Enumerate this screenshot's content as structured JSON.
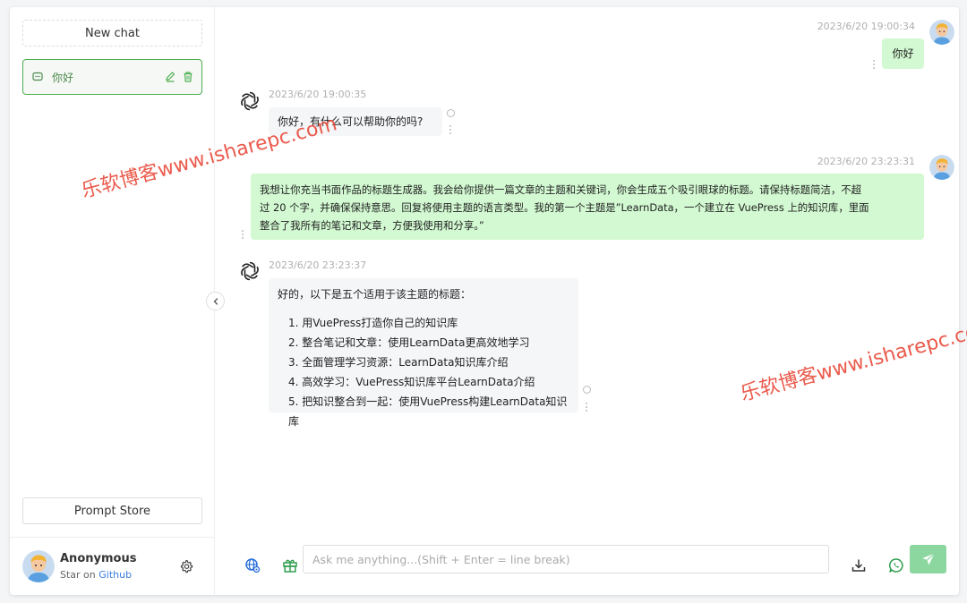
{
  "sidebar": {
    "new_chat_label": "New chat",
    "conversations": [
      {
        "title": "你好"
      }
    ],
    "prompt_store_label": "Prompt Store",
    "user": {
      "name": "Anonymous",
      "sub_prefix": "Star on",
      "sub_link": "Github"
    }
  },
  "messages": [
    {
      "role": "user",
      "time": "2023/6/20 19:00:34",
      "text": "你好"
    },
    {
      "role": "assistant",
      "time": "2023/6/20 19:00:35",
      "text": "你好，有什么可以帮助你的吗?"
    },
    {
      "role": "user",
      "time": "2023/6/20 23:23:31",
      "lines": [
        "我想让你充当书面作品的标题生成器。我会给你提供一篇文章的主题和关键词，你会生成五个吸引眼球的标题。请保持标题简洁，不超",
        "过 20 个字，并确保保持意思。回复将使用主题的语言类型。我的第一个主题是”LearnData，一个建立在 VuePress 上的知识库，里面",
        "整合了我所有的笔记和文章，方便我使用和分享。”"
      ]
    },
    {
      "role": "assistant",
      "time": "2023/6/20 23:23:37",
      "intro": "好的，以下是五个适用于该主题的标题：",
      "items": [
        "1. 用VuePress打造你自己的知识库",
        "2. 整合笔记和文章：使用LearnData更高效地学习",
        "3. 全面管理学习资源：LearnData知识库介绍",
        "4. 高效学习：VuePress知识库平台LearnData介绍",
        "5. 把知识整合到一起：使用VuePress构建LearnData知识库"
      ]
    }
  ],
  "composer": {
    "placeholder": "Ask me anything...(Shift + Enter = line break)"
  },
  "watermark": {
    "text": "乐软博客www.isharepc.com"
  },
  "colors": {
    "accent": "#4caf50",
    "user_bubble": "#d2f9d1",
    "bot_bubble": "#f4f6f8",
    "send_button": "#8cd7a0",
    "watermark": "#e84a3a"
  }
}
